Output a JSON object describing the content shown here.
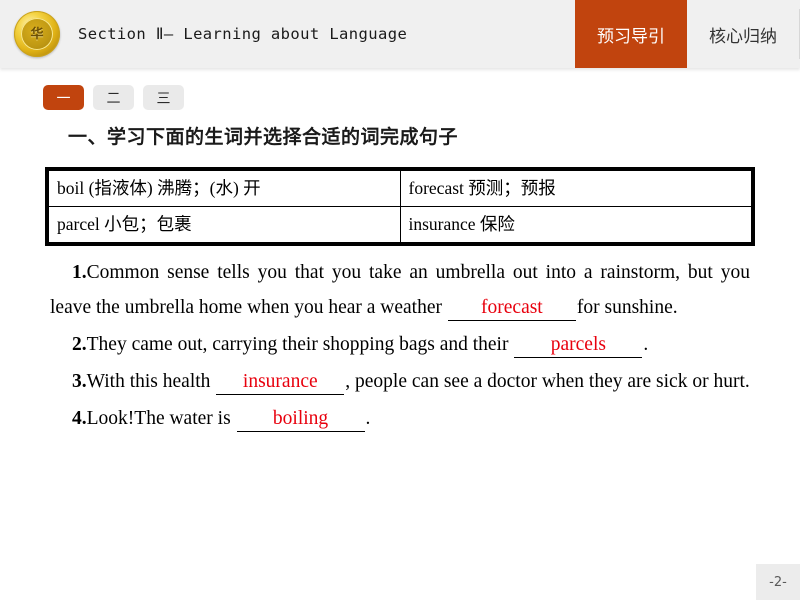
{
  "header": {
    "logo_name": "gold-emblem-logo",
    "logo_glyph": "华",
    "title": "Section Ⅱ— Learning about Language",
    "tabs": [
      {
        "label": "预习导引",
        "active": true
      },
      {
        "label": "核心归纳",
        "active": false
      }
    ],
    "active_color": "#c1440e",
    "background_color": "#f0f0f0"
  },
  "pills": [
    {
      "label": "一",
      "active": true
    },
    {
      "label": "二",
      "active": false
    },
    {
      "label": "三",
      "active": false
    }
  ],
  "section": {
    "title": "一、学习下面的生词并选择合适的词完成句子"
  },
  "vocab_table": {
    "rows": [
      {
        "left": "boil (指液体) 沸腾；(水) 开",
        "right": "forecast 预测；预报"
      },
      {
        "left": "parcel 小包；包裹",
        "right": "insurance 保险"
      }
    ]
  },
  "questions": [
    {
      "num": "1.",
      "part1": "Common sense tells you that you take an umbrella out into a rainstorm, but you leave the umbrella home when you hear a weather ",
      "answer": "forecast",
      "part2": "for sunshine."
    },
    {
      "num": "2.",
      "part1": "They came out, carrying their shopping bags and their ",
      "answer": "parcels",
      "part2": "."
    },
    {
      "num": "3.",
      "part1": "With this health ",
      "answer": "insurance",
      "part2": ", people can see a doctor when they are sick or hurt."
    },
    {
      "num": "4.",
      "part1": "Look!The water is ",
      "answer": "boiling",
      "part2": "."
    }
  ],
  "footer": {
    "page_number": "-2-"
  },
  "colors": {
    "accent": "#c1440e",
    "answer_red": "#e8000d",
    "header_bg": "#f0f0f0",
    "pill_inactive": "#eaeaea"
  }
}
